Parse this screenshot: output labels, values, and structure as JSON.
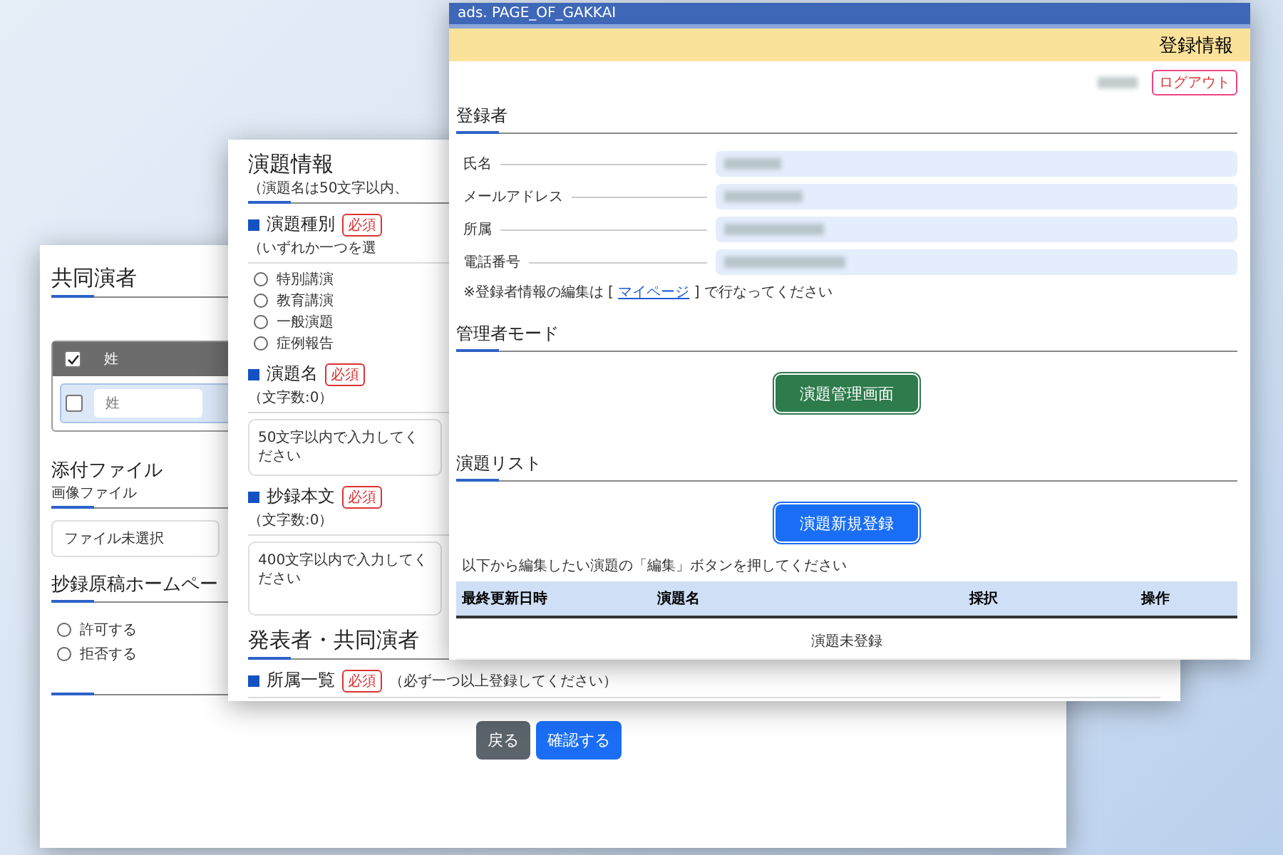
{
  "back_window": {
    "sections": [
      {
        "kind": "table",
        "title": "共同演者",
        "header_check": {
          "checked": true
        },
        "header_label": "姓",
        "rows": [
          {
            "checked": false,
            "placeholder": "姓"
          }
        ]
      },
      {
        "kind": "file",
        "title": "添付ファイル",
        "note": "画像ファイル",
        "file_label": "ファイル未選択"
      },
      {
        "kind": "radio",
        "title": "抄録原稿ホームペー",
        "options": [
          {
            "label": "許可する",
            "selected": false
          },
          {
            "label": "拒否する",
            "selected": false
          }
        ]
      }
    ],
    "buttons": [
      {
        "label": "戻る",
        "kind": "secondary"
      },
      {
        "label": "確認する",
        "kind": "primary"
      }
    ]
  },
  "middle_window": {
    "title": "演題情報",
    "title_note": "（演題名は50文字以内、",
    "fields": [
      {
        "kind": "radio",
        "label": "演題種別",
        "required": "必須",
        "note": "（いずれか一つを選",
        "options": [
          {
            "label": "特別講演",
            "selected": false
          },
          {
            "label": "教育講演",
            "selected": false
          },
          {
            "label": "一般演題",
            "selected": false
          },
          {
            "label": "症例報告",
            "selected": false
          }
        ]
      },
      {
        "kind": "input",
        "label": "演題名",
        "required": "必須",
        "note": "（文字数:0）",
        "placeholder": "50文字以内で入力してください"
      },
      {
        "kind": "textarea",
        "label": "抄録本文",
        "required": "必須",
        "note": "（文字数:0）",
        "placeholder": "400文字以内で入力してください"
      }
    ],
    "section2_title": "発表者・共同演者",
    "section2_field": {
      "label": "所属一覧",
      "required": "必須",
      "note": "（必ず一つ以上登録してください）"
    }
  },
  "front_window": {
    "title": "ads. PAGE_OF_GAKKAI",
    "header": "登録情報",
    "logout": "ログアウト",
    "registrant": {
      "title": "登録者",
      "rows": [
        {
          "label": "氏名"
        },
        {
          "label": "メールアドレス"
        },
        {
          "label": "所属"
        },
        {
          "label": "電話番号"
        }
      ],
      "note_before": "※登録者情報の編集は [ ",
      "note_link": "マイページ",
      "note_after": " ] で行なってください"
    },
    "admin": {
      "title": "管理者モード",
      "button": "演題管理画面"
    },
    "list": {
      "title": "演題リスト",
      "button": "演題新規登録",
      "note": "以下から編集したい演題の「編集」ボタンを押してください",
      "columns": [
        "最終更新日時",
        "演題名",
        "採択",
        "操作"
      ],
      "empty": "演題未登録"
    }
  }
}
